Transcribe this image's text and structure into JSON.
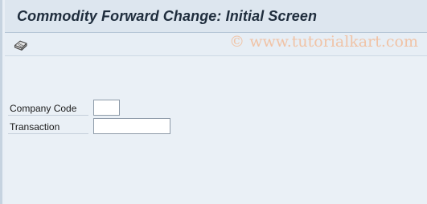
{
  "window": {
    "title": "Commodity Forward Change: Initial Screen"
  },
  "toolbar": {
    "items": [
      {
        "icon": "other-object-icon"
      }
    ]
  },
  "watermark": {
    "text": "© www.tutorialkart.com"
  },
  "form": {
    "company_code": {
      "label": "Company Code",
      "value": ""
    },
    "transaction": {
      "label": "Transaction",
      "value": ""
    }
  },
  "colors": {
    "title_bar": "#dde6ef",
    "background": "#eaf0f6",
    "watermark": "#f0c3a6"
  }
}
